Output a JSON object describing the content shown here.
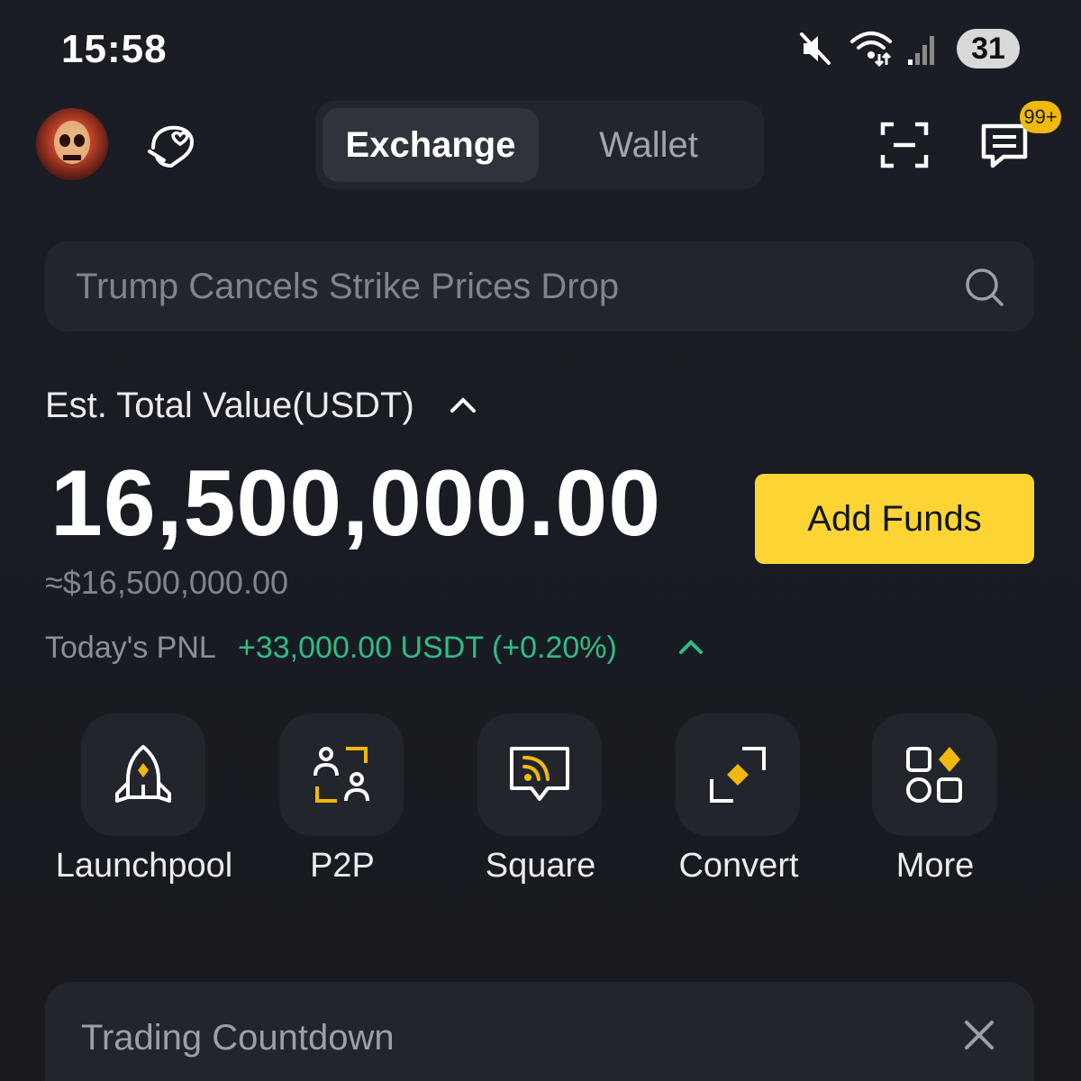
{
  "status_bar": {
    "time": "15:58",
    "battery": "31",
    "icons": [
      "mute-icon",
      "wifi-icon",
      "signal-icon",
      "battery-icon"
    ]
  },
  "header": {
    "tabs": [
      {
        "label": "Exchange",
        "active": true
      },
      {
        "label": "Wallet",
        "active": false
      }
    ],
    "notification_badge": "99+",
    "icons": [
      "avatar",
      "gift-icon",
      "scan-icon",
      "chat-icon"
    ]
  },
  "search": {
    "placeholder": "Trump Cancels Strike Prices Drop"
  },
  "balance": {
    "label": "Est. Total Value(USDT)",
    "amount": "16,500,000.00",
    "approx": "≈$16,500,000.00",
    "add_funds_label": "Add Funds",
    "pnl_label": "Today's PNL",
    "pnl_value": "+33,000.00 USDT  (+0.20%)"
  },
  "shortcuts": [
    {
      "label": "Launchpool",
      "icon": "rocket-icon"
    },
    {
      "label": "P2P",
      "icon": "p2p-icon"
    },
    {
      "label": "Square",
      "icon": "square-feed-icon"
    },
    {
      "label": "Convert",
      "icon": "convert-icon"
    },
    {
      "label": "More",
      "icon": "more-grid-icon"
    }
  ],
  "card": {
    "title": "Trading Countdown"
  },
  "colors": {
    "background": "#181a20",
    "surface": "#22252c",
    "accent": "#fcd535",
    "positive": "#2ebd85",
    "muted": "#7f858f"
  }
}
